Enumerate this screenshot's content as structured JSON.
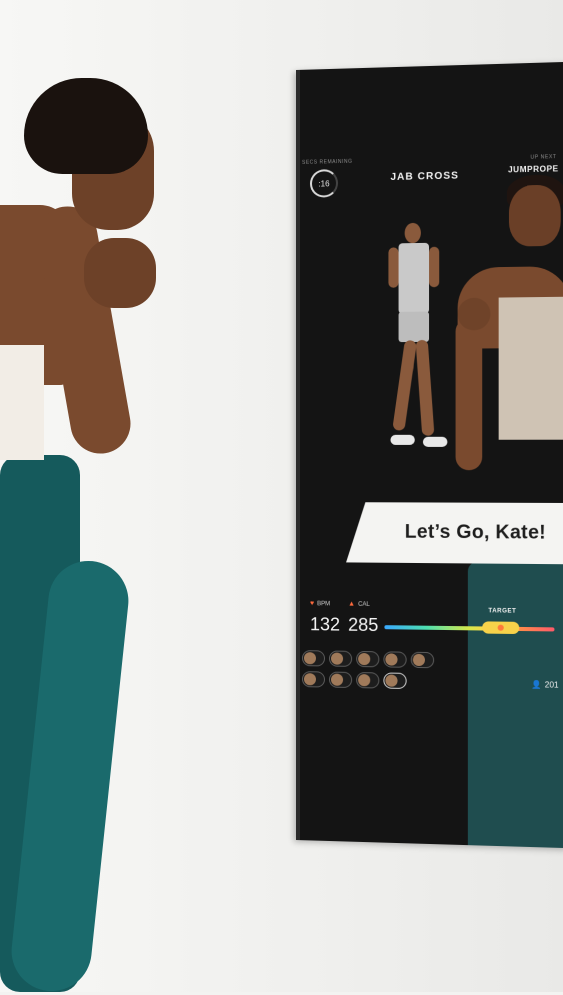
{
  "workout": {
    "secs_remaining_label": "SECS REMAINING",
    "timer": ":16",
    "current_move": "JAB CROSS",
    "up_next_label": "UP NEXT",
    "up_next": "JUMPROPE"
  },
  "banner": {
    "message": "Let’s Go, Kate!"
  },
  "stats": {
    "bpm_label": "BPM",
    "bpm_value": "132",
    "cal_label": "CAL",
    "cal_value": "285",
    "target_label": "TARGET"
  },
  "leaderboard": {
    "row1": [
      "",
      "",
      "",
      "",
      ""
    ],
    "row2": [
      "",
      "",
      "",
      ""
    ],
    "participant_count": "201"
  },
  "colors": {
    "mirror_bg": "#141414",
    "accent_orange": "#ff6a3d",
    "target_pill": "#f7d24a"
  }
}
